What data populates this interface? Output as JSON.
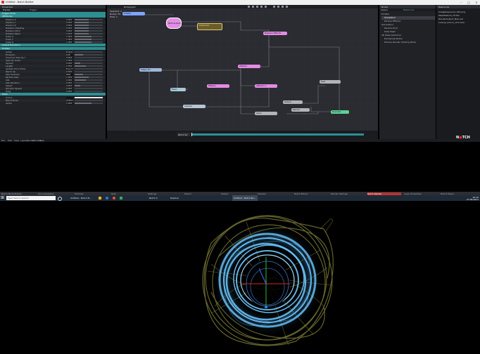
{
  "window": {
    "title": "Untitled - Notch Builder",
    "menu": [
      "File",
      "Edit",
      "View",
      "Layers",
      "Render",
      "Window",
      "Help"
    ]
  },
  "left_panel": {
    "header": "Properties",
    "tabs": [
      "Tracker",
      "Trigger"
    ],
    "section_top": "Trigger Node",
    "sections": [
      {
        "label": "Attributes",
        "rows": [
          {
            "label": "Position X",
            "value": "0.0000",
            "fill": 0.5
          },
          {
            "label": "Position Y",
            "value": "0.0000",
            "fill": 0.5
          },
          {
            "label": "Position Z",
            "value": "0.0000",
            "fill": 0.5
          },
          {
            "label": "Rotation Heading",
            "value": "0.0000",
            "fill": 0.5
          },
          {
            "label": "Rotation Pitch",
            "value": "0.0000",
            "fill": 0.5
          },
          {
            "label": "Rotation Bank",
            "value": "0.0000",
            "fill": 0.5
          },
          {
            "label": "Scale X",
            "value": "1.0000",
            "fill": 0.6
          },
          {
            "label": "Scale Y",
            "value": "1.0000",
            "fill": 0.6
          },
          {
            "label": "Scale Z",
            "value": "1.0000",
            "fill": 0.6
          }
        ]
      },
      {
        "label": "Inherit Transform",
        "rows": []
      },
      {
        "label": "Emitter",
        "rows": [
          {
            "label": "Active",
            "value": "Enabled",
            "fill": 0
          },
          {
            "label": "Emission",
            "value": "1000",
            "fill": 0.3
          },
          {
            "label": "Override Velocity Y",
            "value": "0.0000",
            "fill": 0
          },
          {
            "label": "Velocity Scale",
            "value": "1.0000",
            "fill": 0
          },
          {
            "label": "Spread",
            "value": "0.2000",
            "fill": 0.2
          },
          {
            "label": "Length",
            "value": "1.0000",
            "fill": 0.4
          },
          {
            "label": "Update Time Mode",
            "value": "Every Frame",
            "fill": 0
          },
          {
            "label": "Warm Up",
            "value": "0.0000",
            "fill": 0
          },
          {
            "label": "Max Particles",
            "value": "4000",
            "fill": 0.3
          },
          {
            "label": "Particle Size",
            "value": "1.0000",
            "fill": 0.5
          },
          {
            "label": "Life",
            "value": "2.0000",
            "fill": 0.4
          },
          {
            "label": "Life Variation",
            "value": "0.0000",
            "fill": 0
          },
          {
            "label": "Speed",
            "value": "0.0500",
            "fill": 0.2
          },
          {
            "label": "Random Speed",
            "value": "0.0000",
            "fill": 0
          },
          {
            "label": "Drag",
            "value": "0.0000",
            "fill": 0
          }
        ]
      },
      {
        "label": "Mesh",
        "rows": [
          {
            "label": "Colour",
            "value": "",
            "fill": 1
          },
          {
            "label": "Blend Mode",
            "value": "Additive",
            "fill": 0
          },
          {
            "label": "Alpha",
            "value": "1.0000",
            "fill": 0.6
          }
        ]
      }
    ]
  },
  "graph": {
    "tab": "Nodegraph",
    "info": [
      "Selected: 1",
      "Nodes: 25",
      "Total: 1"
    ],
    "nodes": [
      {
        "label": "Emitter",
        "color": "#7fa6ff",
        "kind": "blue"
      },
      {
        "label": "Particle Root",
        "color": "#e38ce5",
        "kind": "pink"
      },
      {
        "label": "Comment",
        "color": "#c9b15b",
        "kind": "comment"
      },
      {
        "label": "Displace Effector",
        "color": "#e38ce5",
        "kind": "pink"
      },
      {
        "label": "Affector",
        "color": "#e38ce5",
        "kind": "pink"
      },
      {
        "label": "Shape 3D",
        "color": "#9fb6d8",
        "kind": "grey"
      },
      {
        "label": "Mesh",
        "color": "#a7c8d6",
        "kind": "grey"
      },
      {
        "label": "Effector",
        "color": "#e38ce5",
        "kind": "pink"
      },
      {
        "label": "Affector 2",
        "color": "#e38ce5",
        "kind": "pink"
      },
      {
        "label": "Camera",
        "color": "#b8c4d4",
        "kind": "grey"
      },
      {
        "label": "Root",
        "color": "#b0b4ba",
        "kind": "grey"
      },
      {
        "label": "Output",
        "color": "#b0b4ba",
        "kind": "grey"
      },
      {
        "label": "Render",
        "color": "#b0b4ba",
        "kind": "grey"
      },
      {
        "label": "Layer",
        "color": "#b0b4ba",
        "kind": "grey"
      },
      {
        "label": "Final Out",
        "color": "#5ecf9a",
        "kind": "green"
      }
    ],
    "timeline_time": "00:17:19"
  },
  "right_panel": {
    "header": "Nodes",
    "tabs": [
      "Layers",
      "Resources"
    ],
    "items": [
      "Emitter",
      "Simulation",
      "Particle Effector",
      "Generators",
      "Particle Root",
      "Data Mesh",
      "3D Mesh Deformer",
      "Rendering Nodes",
      "Particle Render Shading Mode"
    ]
  },
  "far_right": {
    "header": "Resources",
    "items": [
      "ImageSequence_001.png",
      "MeshDeform_FX.fbx",
      "RenderOutput_Main.exr",
      "Lookup_Colour_LUT.cube"
    ]
  },
  "tabsrow": {
    "items": [
      "Notch Node Builder",
      "Documentation",
      "Tutorials",
      "Help",
      "Settings",
      "Export",
      "Output",
      "Preview",
      "Notch Blocks",
      "Render Settings",
      "Notch Render",
      "Layer Properties",
      "Notch Player"
    ]
  },
  "taskbar": {
    "search_placeholder": "Type here to search",
    "apps": [
      {
        "label": "Untitled - Notch B..."
      },
      {
        "label": "Notch 2"
      },
      {
        "label": "Explorer"
      },
      {
        "label": "Untitled - Notch Bu..."
      }
    ],
    "clock_time": "10:15",
    "clock_date": "27.09.2021"
  },
  "colors": {
    "accent_teal": "#2d8f93",
    "node_pink": "#e38ce5",
    "node_blue": "#7fa6ff",
    "node_green": "#5ecf9a",
    "mesh_olive": "#8a8a3a",
    "mesh_blue": "#6ec8ff"
  }
}
